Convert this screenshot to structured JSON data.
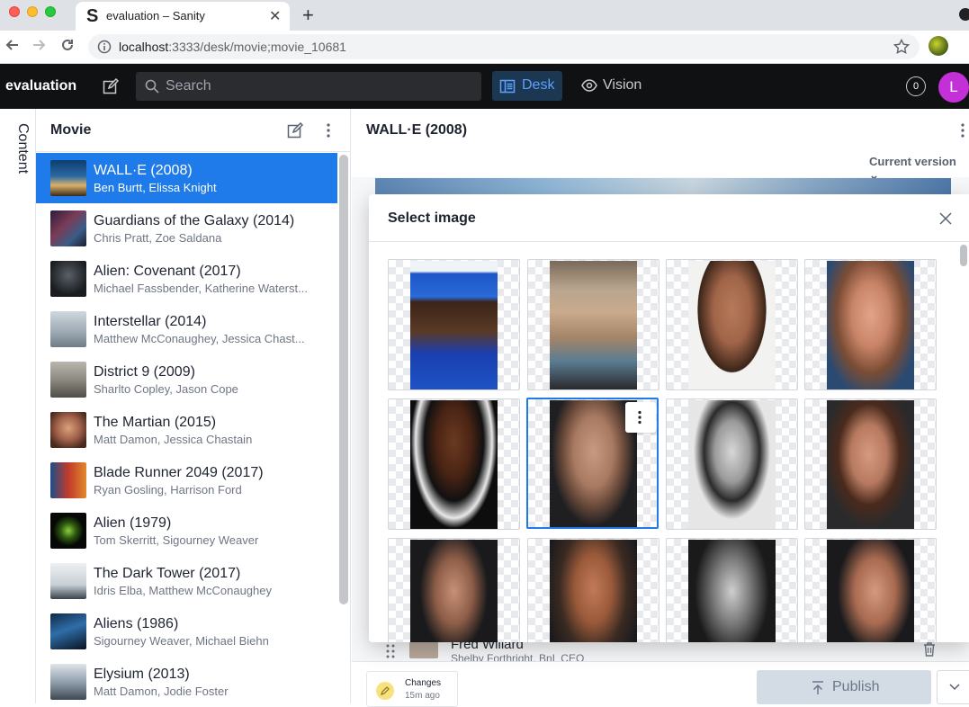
{
  "browser": {
    "tab_title": "evaluation – Sanity",
    "tab_favicon": "S",
    "url_host": "localhost",
    "url_path": ":3333/desk/movie;movie_10681"
  },
  "navbar": {
    "brand": "evaluation",
    "search_placeholder": "Search",
    "tools": [
      {
        "label": "Desk",
        "icon": "desk-icon",
        "active": true
      },
      {
        "label": "Vision",
        "icon": "eye-icon",
        "active": false
      }
    ],
    "notifications": "0",
    "user_initial": "L",
    "accent": "#c330d7"
  },
  "rail": {
    "label": "Content"
  },
  "list_pane": {
    "title": "Movie",
    "items": [
      {
        "title": "WALL·E (2008)",
        "subtitle": "Ben Burtt, Elissa Knight",
        "active": true
      },
      {
        "title": "Guardians of the Galaxy (2014)",
        "subtitle": "Chris Pratt, Zoe Saldana"
      },
      {
        "title": "Alien: Covenant (2017)",
        "subtitle": "Michael Fassbender, Katherine Waterst..."
      },
      {
        "title": "Interstellar (2014)",
        "subtitle": "Matthew McConaughey, Jessica Chast..."
      },
      {
        "title": "District 9 (2009)",
        "subtitle": "Sharlto Copley, Jason Cope"
      },
      {
        "title": "The Martian (2015)",
        "subtitle": "Matt Damon, Jessica Chastain"
      },
      {
        "title": "Blade Runner 2049 (2017)",
        "subtitle": "Ryan Gosling, Harrison Ford"
      },
      {
        "title": "Alien (1979)",
        "subtitle": "Tom Skerritt, Sigourney Weaver"
      },
      {
        "title": "The Dark Tower (2017)",
        "subtitle": "Idris Elba, Matthew McConaughey"
      },
      {
        "title": "Aliens (1986)",
        "subtitle": "Sigourney Weaver, Michael Biehn"
      },
      {
        "title": "Elysium (2013)",
        "subtitle": "Matt Damon, Jodie Foster"
      }
    ]
  },
  "document": {
    "title": "WALL·E (2008)",
    "version": "Current version",
    "reference": {
      "name": "Fred Willard",
      "role": "Shelby Forthright, BnL CEO"
    },
    "changes_label": "Changes",
    "changes_time": "15m ago",
    "publish_label": "Publish"
  },
  "dialog": {
    "title": "Select image",
    "selected_index": 5
  },
  "colors": {
    "active_item": "#1e7be9",
    "navbar_bg": "#101112",
    "desk_active": "#5ea2ff"
  }
}
